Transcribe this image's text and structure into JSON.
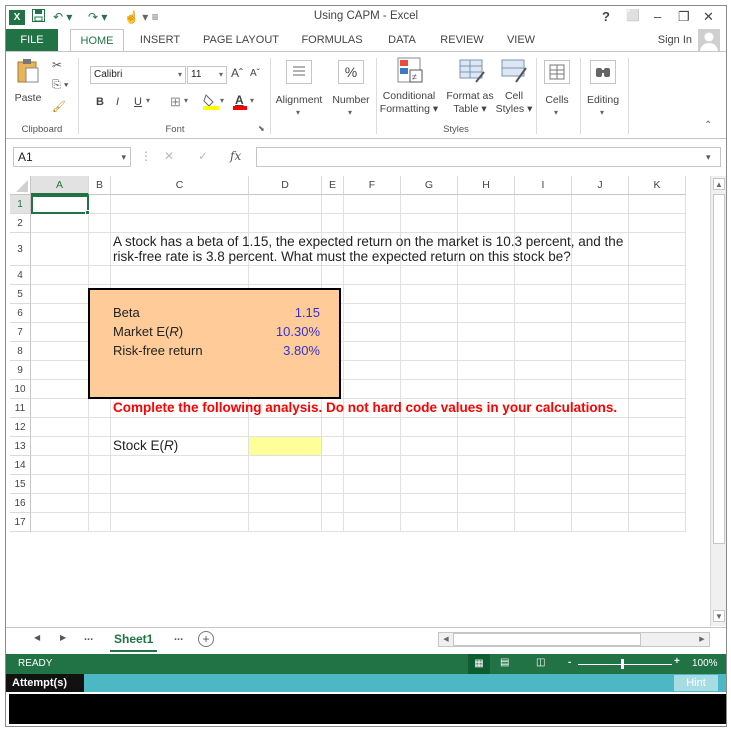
{
  "window": {
    "title": "Using CAPM - Excel",
    "help": "?",
    "controls": [
      "⬜",
      "–",
      "❐",
      "✕"
    ]
  },
  "ribbon_tabs": [
    "FILE",
    "HOME",
    "INSERT",
    "PAGE LAYOUT",
    "FORMULAS",
    "DATA",
    "REVIEW",
    "VIEW"
  ],
  "sign_in": "Sign In",
  "ribbon": {
    "paste": "Paste",
    "clipboard": "Clipboard",
    "font_name": "Calibri",
    "font_size": "11",
    "bold": "B",
    "italic": "I",
    "underline": "U",
    "font_group": "Font",
    "alignment": "Alignment",
    "number": "Number",
    "conditional_formatting": [
      "Conditional",
      "Formatting"
    ],
    "format_as_table": [
      "Format as",
      "Table"
    ],
    "cell_styles": [
      "Cell",
      "Styles"
    ],
    "styles_group": "Styles",
    "cells": "Cells",
    "editing": "Editing",
    "grow_font": "A",
    "shrink_font": "A",
    "percent": "%"
  },
  "formula_bar": {
    "name_box": "A1",
    "fx": "fx",
    "cancel": "✕",
    "enter": "✓",
    "content": ""
  },
  "columns": [
    "A",
    "B",
    "C",
    "D",
    "E",
    "F",
    "G",
    "H",
    "I",
    "J",
    "K"
  ],
  "rows": [
    "1",
    "2",
    "3",
    "4",
    "5",
    "6",
    "7",
    "8",
    "9",
    "10",
    "11",
    "12",
    "13",
    "14",
    "15",
    "16",
    "17"
  ],
  "sheet": {
    "question_line1": "A stock has a beta of 1.15, the expected return on the market is 10.3 percent, and the",
    "question_line2": "risk-free rate is 3.8 percent. What must the expected return on this stock be?",
    "inputs": [
      {
        "label": "Beta",
        "value": "1.15"
      },
      {
        "label_prefix": "Market E(",
        "label_italic": "R",
        "label_suffix": ")",
        "value": "10.30%"
      },
      {
        "label": "Risk-free return",
        "value": "3.80%"
      }
    ],
    "instruction": "Complete the following analysis. Do not hard code values in your calculations.",
    "output_label_prefix": "Stock E(",
    "output_label_italic": "R",
    "output_label_suffix": ")",
    "output_value": ""
  },
  "colors": {
    "excel_green": "#217346",
    "input_box": "#ffcc99",
    "input_value": "#3333cc",
    "instruction": "#ff0000",
    "answer_cell": "#ffff99"
  },
  "sheet_tabs": {
    "nav_prev": "◀",
    "nav_next": "▶",
    "ellipsis_left": "...",
    "active": "Sheet1",
    "ellipsis_right": "...",
    "add": "+"
  },
  "status_bar": {
    "state": "READY",
    "zoom": "100%"
  },
  "attempt_bar": {
    "label": "Attempt(s)",
    "hint": "Hint"
  }
}
